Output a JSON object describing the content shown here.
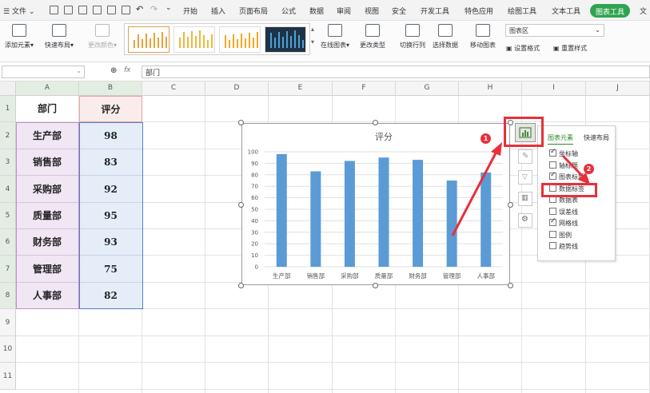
{
  "menubar": {
    "file_label": "文件",
    "tabs": [
      "开始",
      "插入",
      "页面布局",
      "公式",
      "数据",
      "审阅",
      "视图",
      "安全",
      "开发工具",
      "特色应用",
      "绘图工具",
      "文本工具",
      "图表工具",
      "文"
    ],
    "active_tab": "图表工具"
  },
  "ribbon": {
    "add_element": "添加元素",
    "quick_layout": "快速布局",
    "change_color": "更改颜色",
    "online_chart": "在线图表",
    "change_type": "更改类型",
    "switch_rowcol": "切换行列",
    "select_data": "选择数据",
    "move_chart": "移动图表",
    "chart_area_select": "图表区",
    "set_format": "设置格式",
    "reset_style": "重置样式"
  },
  "formula": {
    "fx": "fx",
    "value": "部门"
  },
  "sheet": {
    "columns": [
      "A",
      "B",
      "C",
      "D",
      "E",
      "F",
      "G",
      "H",
      "I",
      "J"
    ],
    "rows": [
      "1",
      "2",
      "3",
      "4",
      "5",
      "6",
      "7",
      "8",
      "9",
      "10",
      "11"
    ],
    "header_a": "部门",
    "header_b": "评分",
    "departments": [
      "生产部",
      "销售部",
      "采购部",
      "质量部",
      "财务部",
      "管理部",
      "人事部"
    ],
    "scores": [
      "98",
      "83",
      "92",
      "95",
      "93",
      "75",
      "82"
    ]
  },
  "chart_data": {
    "type": "bar",
    "title": "评分",
    "categories": [
      "生产部",
      "销售部",
      "采购部",
      "质量部",
      "财务部",
      "管理部",
      "人事部"
    ],
    "values": [
      98,
      83,
      92,
      95,
      93,
      75,
      82
    ],
    "ylim": [
      0,
      100
    ],
    "yticks": [
      "0",
      "10",
      "20",
      "30",
      "40",
      "50",
      "60",
      "70",
      "80",
      "90",
      "100"
    ],
    "grid": true,
    "color": "#5b9bd5"
  },
  "panel": {
    "tab_elements": "图表元素",
    "tab_quick": "快速布局",
    "options": [
      {
        "label": "坐标轴",
        "checked": true
      },
      {
        "label": "轴标题",
        "checked": false
      },
      {
        "label": "图表标题",
        "checked": true
      },
      {
        "label": "数据标签",
        "checked": false
      },
      {
        "label": "数据表",
        "checked": false
      },
      {
        "label": "误差线",
        "checked": false
      },
      {
        "label": "网格线",
        "checked": true
      },
      {
        "label": "图例",
        "checked": false
      },
      {
        "label": "趋势线",
        "checked": false
      }
    ]
  },
  "annotations": {
    "badge1": "1",
    "badge2": "2",
    "color": "#e8303a"
  }
}
